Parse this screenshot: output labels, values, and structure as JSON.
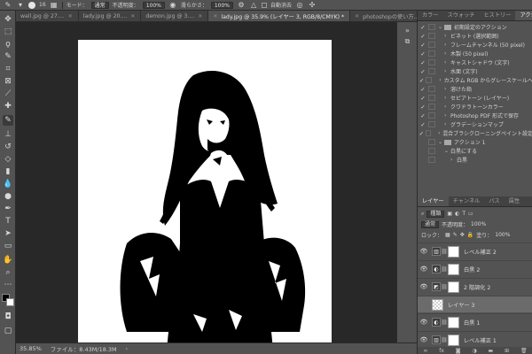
{
  "options_bar": {
    "brush_size": "16",
    "mode_label": "モード：",
    "mode_value": "通常",
    "opacity_label": "不透明度：",
    "opacity_value": "100%",
    "smoothing_label": "滑らかさ：",
    "smoothing_value": "100%",
    "auto_erase_label": "自動消去"
  },
  "tabs": [
    {
      "label": "wall.jpg @ 27....",
      "active": false
    },
    {
      "label": "lady.jpg @ 20....",
      "active": false
    },
    {
      "label": "demon.jpg @ 3....",
      "active": false
    },
    {
      "label": "lady.jpg @ 35.9% (レイヤー 3, RGB/8/CMYK) *",
      "active": true
    },
    {
      "label": "photoshopの使い方...",
      "active": false
    }
  ],
  "status": {
    "zoom": "35.85%",
    "file_info": "ファイル：8.43M/18.3M"
  },
  "actions_panel": {
    "tabs": [
      "カラー",
      "スウォッチ",
      "ヒストリー",
      "アクション"
    ],
    "active_tab": "アクション",
    "rows": [
      {
        "label": "初期設定のアクション",
        "checked": true,
        "level": 0,
        "type": "set"
      },
      {
        "label": "ビネット (選択範囲)",
        "checked": true,
        "level": 1,
        "type": "action"
      },
      {
        "label": "フレームチャンネル (50 pixel)",
        "checked": true,
        "level": 1,
        "type": "action"
      },
      {
        "label": "木製 (50 pixel)",
        "checked": true,
        "level": 1,
        "type": "action"
      },
      {
        "label": "キャストシャドウ (文字)",
        "checked": true,
        "level": 1,
        "type": "action"
      },
      {
        "label": "水面 (文字)",
        "checked": true,
        "level": 1,
        "type": "action"
      },
      {
        "label": "カスタム RGB からグレースケールへ",
        "checked": true,
        "level": 1,
        "type": "action"
      },
      {
        "label": "溶けた鉛",
        "checked": true,
        "level": 1,
        "type": "action"
      },
      {
        "label": "セピアトーン (レイヤー)",
        "checked": true,
        "level": 1,
        "type": "action"
      },
      {
        "label": "クワドラトーンカラー",
        "checked": true,
        "level": 1,
        "type": "action"
      },
      {
        "label": "Photoshop PDF 形式で保存",
        "checked": true,
        "level": 1,
        "type": "action"
      },
      {
        "label": "グラデーションマップ",
        "checked": true,
        "level": 1,
        "type": "action"
      },
      {
        "label": "混合ブラシクローニングペイント設定",
        "checked": true,
        "level": 1,
        "type": "action"
      },
      {
        "label": "アクション 1",
        "checked": false,
        "level": 0,
        "type": "set"
      },
      {
        "label": "白黒にする",
        "checked": false,
        "level": 1,
        "type": "action"
      },
      {
        "label": "白黒",
        "checked": false,
        "level": 2,
        "type": "step"
      }
    ]
  },
  "layers_panel": {
    "tabs": [
      "レイヤー",
      "チャンネル",
      "パス",
      "属性"
    ],
    "active_tab": "レイヤー",
    "filter_label": "種類",
    "blend_mode": "通常",
    "opacity_label": "不透明度：",
    "opacity_value": "100%",
    "lock_label": "ロック：",
    "fill_label": "塗り：",
    "fill_value": "100%",
    "layers": [
      {
        "name": "レベル補正 2",
        "type": "adjustment",
        "icon": "levels",
        "visible": true,
        "selected": false
      },
      {
        "name": "白黒 2",
        "type": "adjustment",
        "icon": "bw",
        "visible": true,
        "selected": false
      },
      {
        "name": "2 階調化 2",
        "type": "adjustment",
        "icon": "threshold",
        "visible": true,
        "selected": false
      },
      {
        "name": "レイヤー 3",
        "type": "pixel",
        "icon": "transparent",
        "visible": false,
        "selected": true
      },
      {
        "name": "白黒 1",
        "type": "adjustment",
        "icon": "bw",
        "visible": true,
        "selected": false
      },
      {
        "name": "レベル補正 1",
        "type": "adjustment",
        "icon": "levels",
        "visible": true,
        "selected": false
      }
    ]
  },
  "colors": {
    "panel_bg": "#535353",
    "canvas_bg": "#282828",
    "selected_layer": "#6b6b6b"
  }
}
